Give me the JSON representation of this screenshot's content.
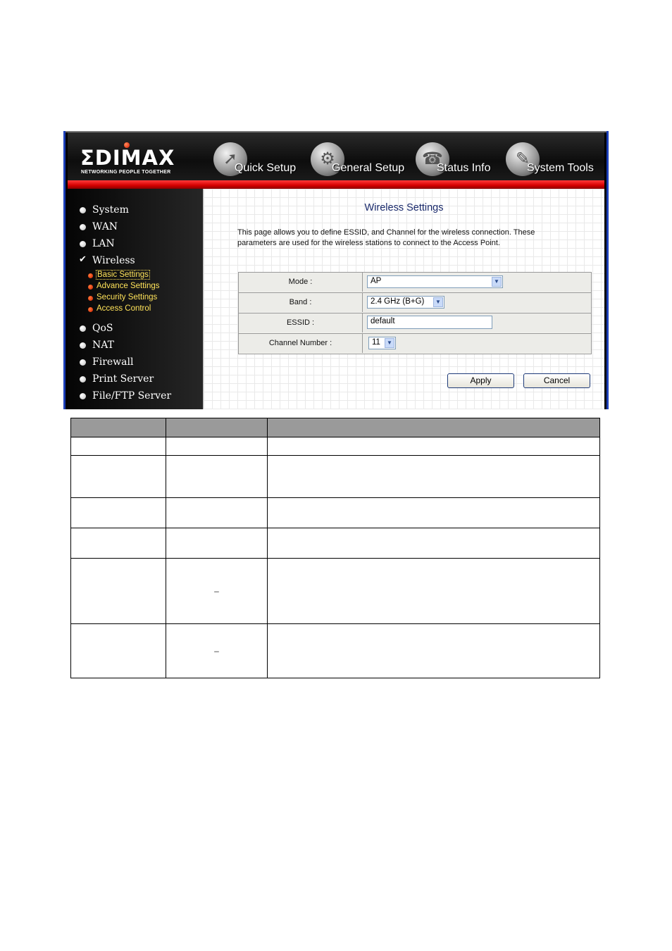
{
  "brand": {
    "name": "ΣDIMAX",
    "tagline": "NETWORKING PEOPLE TOGETHER"
  },
  "top_nav": [
    {
      "label": "Quick Setup",
      "icon": "quick-setup-icon"
    },
    {
      "label": "General Setup",
      "icon": "general-setup-icon"
    },
    {
      "label": "Status Info",
      "icon": "status-info-icon"
    },
    {
      "label": "System Tools",
      "icon": "system-tools-icon"
    }
  ],
  "sidebar": {
    "items": [
      {
        "label": "System"
      },
      {
        "label": "WAN"
      },
      {
        "label": "LAN"
      },
      {
        "label": "Wireless",
        "checked": true
      },
      {
        "label": "QoS"
      },
      {
        "label": "NAT"
      },
      {
        "label": "Firewall"
      },
      {
        "label": "Print Server"
      },
      {
        "label": "File/FTP Server"
      }
    ],
    "wireless_sub": [
      {
        "label": "Basic Settings",
        "active": true
      },
      {
        "label": "Advance Settings"
      },
      {
        "label": "Security Settings"
      },
      {
        "label": "Access Control"
      }
    ]
  },
  "main": {
    "title": "Wireless Settings",
    "description": "This page allows you to define ESSID, and Channel for the wireless connection. These parameters are used for the wireless stations to connect to the Access Point.",
    "form": {
      "mode": {
        "label": "Mode :",
        "value": "AP"
      },
      "band": {
        "label": "Band :",
        "value": "2.4 GHz (B+G)"
      },
      "essid": {
        "label": "ESSID :",
        "value": "default"
      },
      "channel": {
        "label": "Channel Number :",
        "value": "11"
      }
    },
    "buttons": {
      "apply": "Apply",
      "cancel": "Cancel"
    }
  },
  "desc_table": {
    "dash": "–"
  },
  "colors": {
    "header_red": "#d40000",
    "frame_blue": "#1c3fb8",
    "submenu_yellow": "#ffe35a",
    "title_blue": "#1a2a6c",
    "table_header_gray": "#9a9a9a"
  }
}
